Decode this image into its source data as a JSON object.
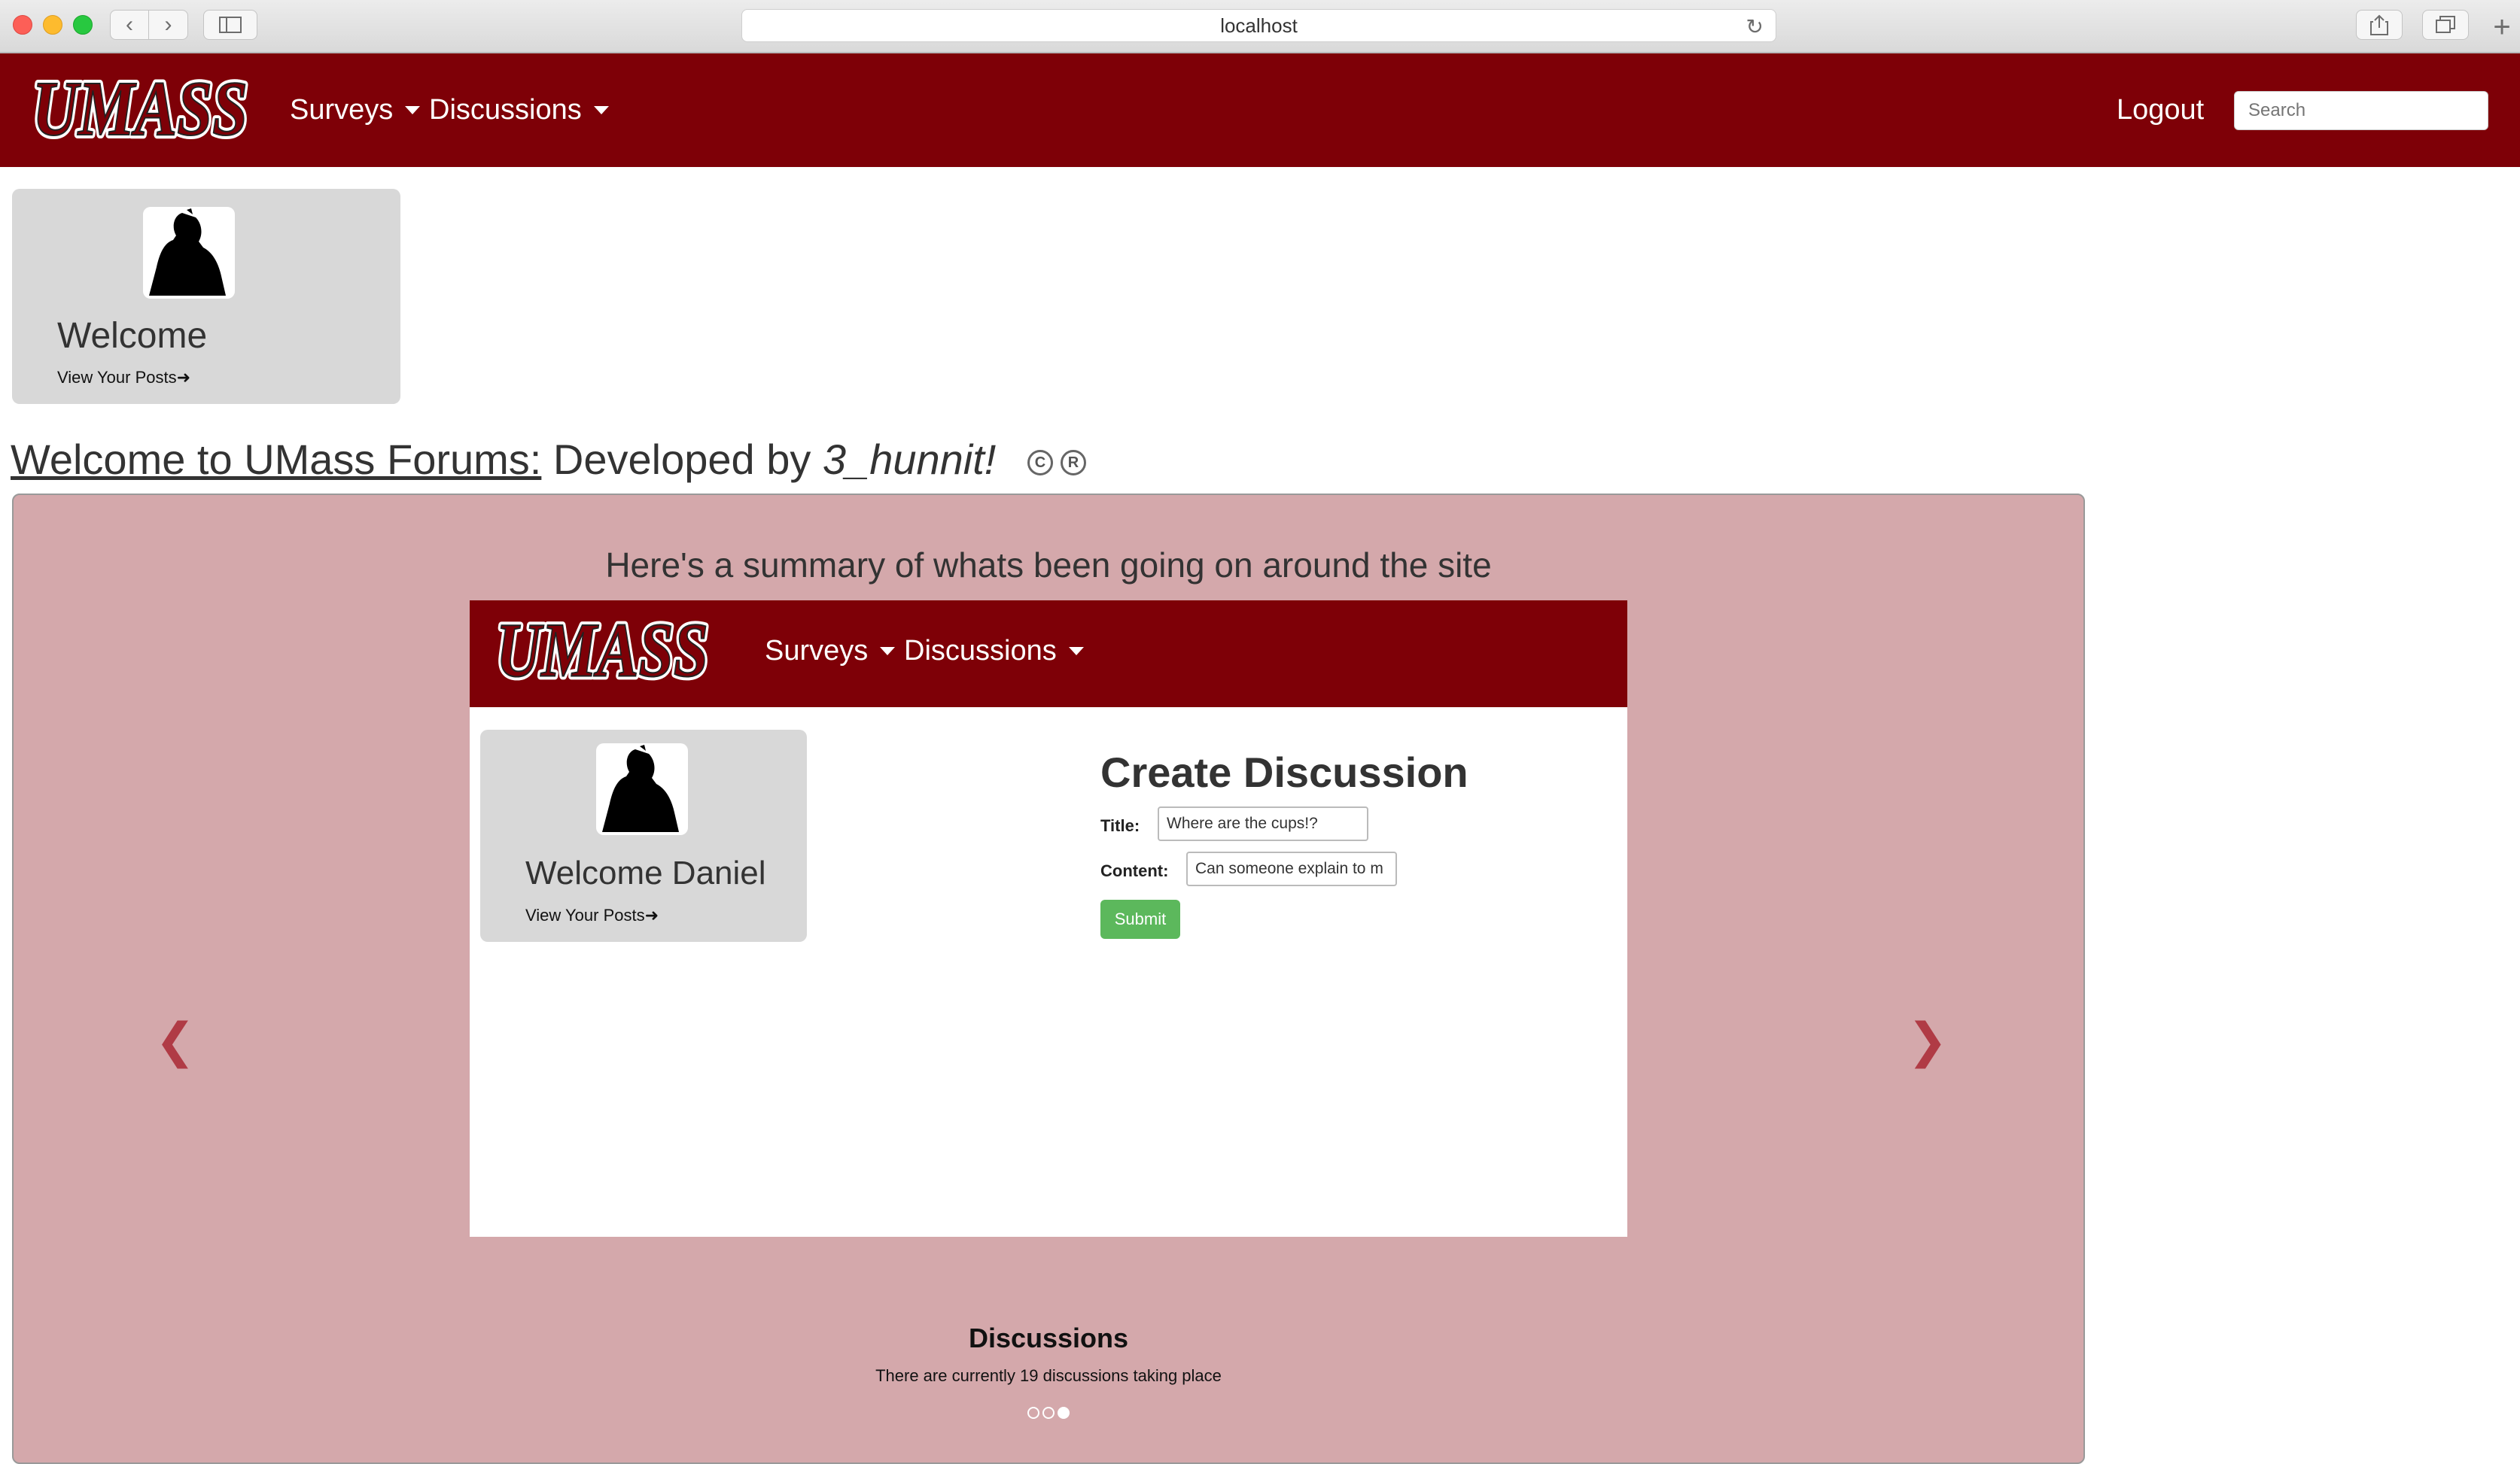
{
  "browser": {
    "url": "localhost",
    "icons": {
      "back": "chevron-left-icon",
      "forward": "chevron-right-icon",
      "sidebar": "sidebar-icon",
      "reload": "reload-icon",
      "share": "share-icon",
      "tabs": "tabs-icon",
      "new_tab": "plus-icon"
    }
  },
  "navbar": {
    "logo_text": "UMass",
    "menu": [
      {
        "label": "Surveys"
      },
      {
        "label": "Discussions"
      }
    ],
    "logout_label": "Logout",
    "search_placeholder": "Search",
    "background": "#7e0007"
  },
  "welcome_card": {
    "title": "Welcome",
    "link": "View Your Posts"
  },
  "heading": {
    "link_text": "Welcome to UMass Forums:",
    "text": "Developed by",
    "team": "3_hunnit!",
    "copyright": "C",
    "registered": "R"
  },
  "carousel": {
    "heading": "Here's a summary of whats been going on around the site",
    "background": "#d4a8ab",
    "prev_icon": "chevron-left-icon",
    "next_icon": "chevron-right-icon",
    "slide": {
      "menu": [
        {
          "label": "Surveys"
        },
        {
          "label": "Discussions"
        }
      ],
      "card_title": "Welcome Daniel",
      "card_link": "View Your Posts",
      "form_title": "Create Discussion",
      "title_label": "Title:",
      "title_value": "Where are the cups!?",
      "content_label": "Content:",
      "content_value": "Can someone explain to m",
      "submit_label": "Submit"
    },
    "caption_title": "Discussions",
    "caption_text": "There are currently 19 discussions taking place",
    "indicators": {
      "count": 3,
      "active_index": 2
    }
  }
}
